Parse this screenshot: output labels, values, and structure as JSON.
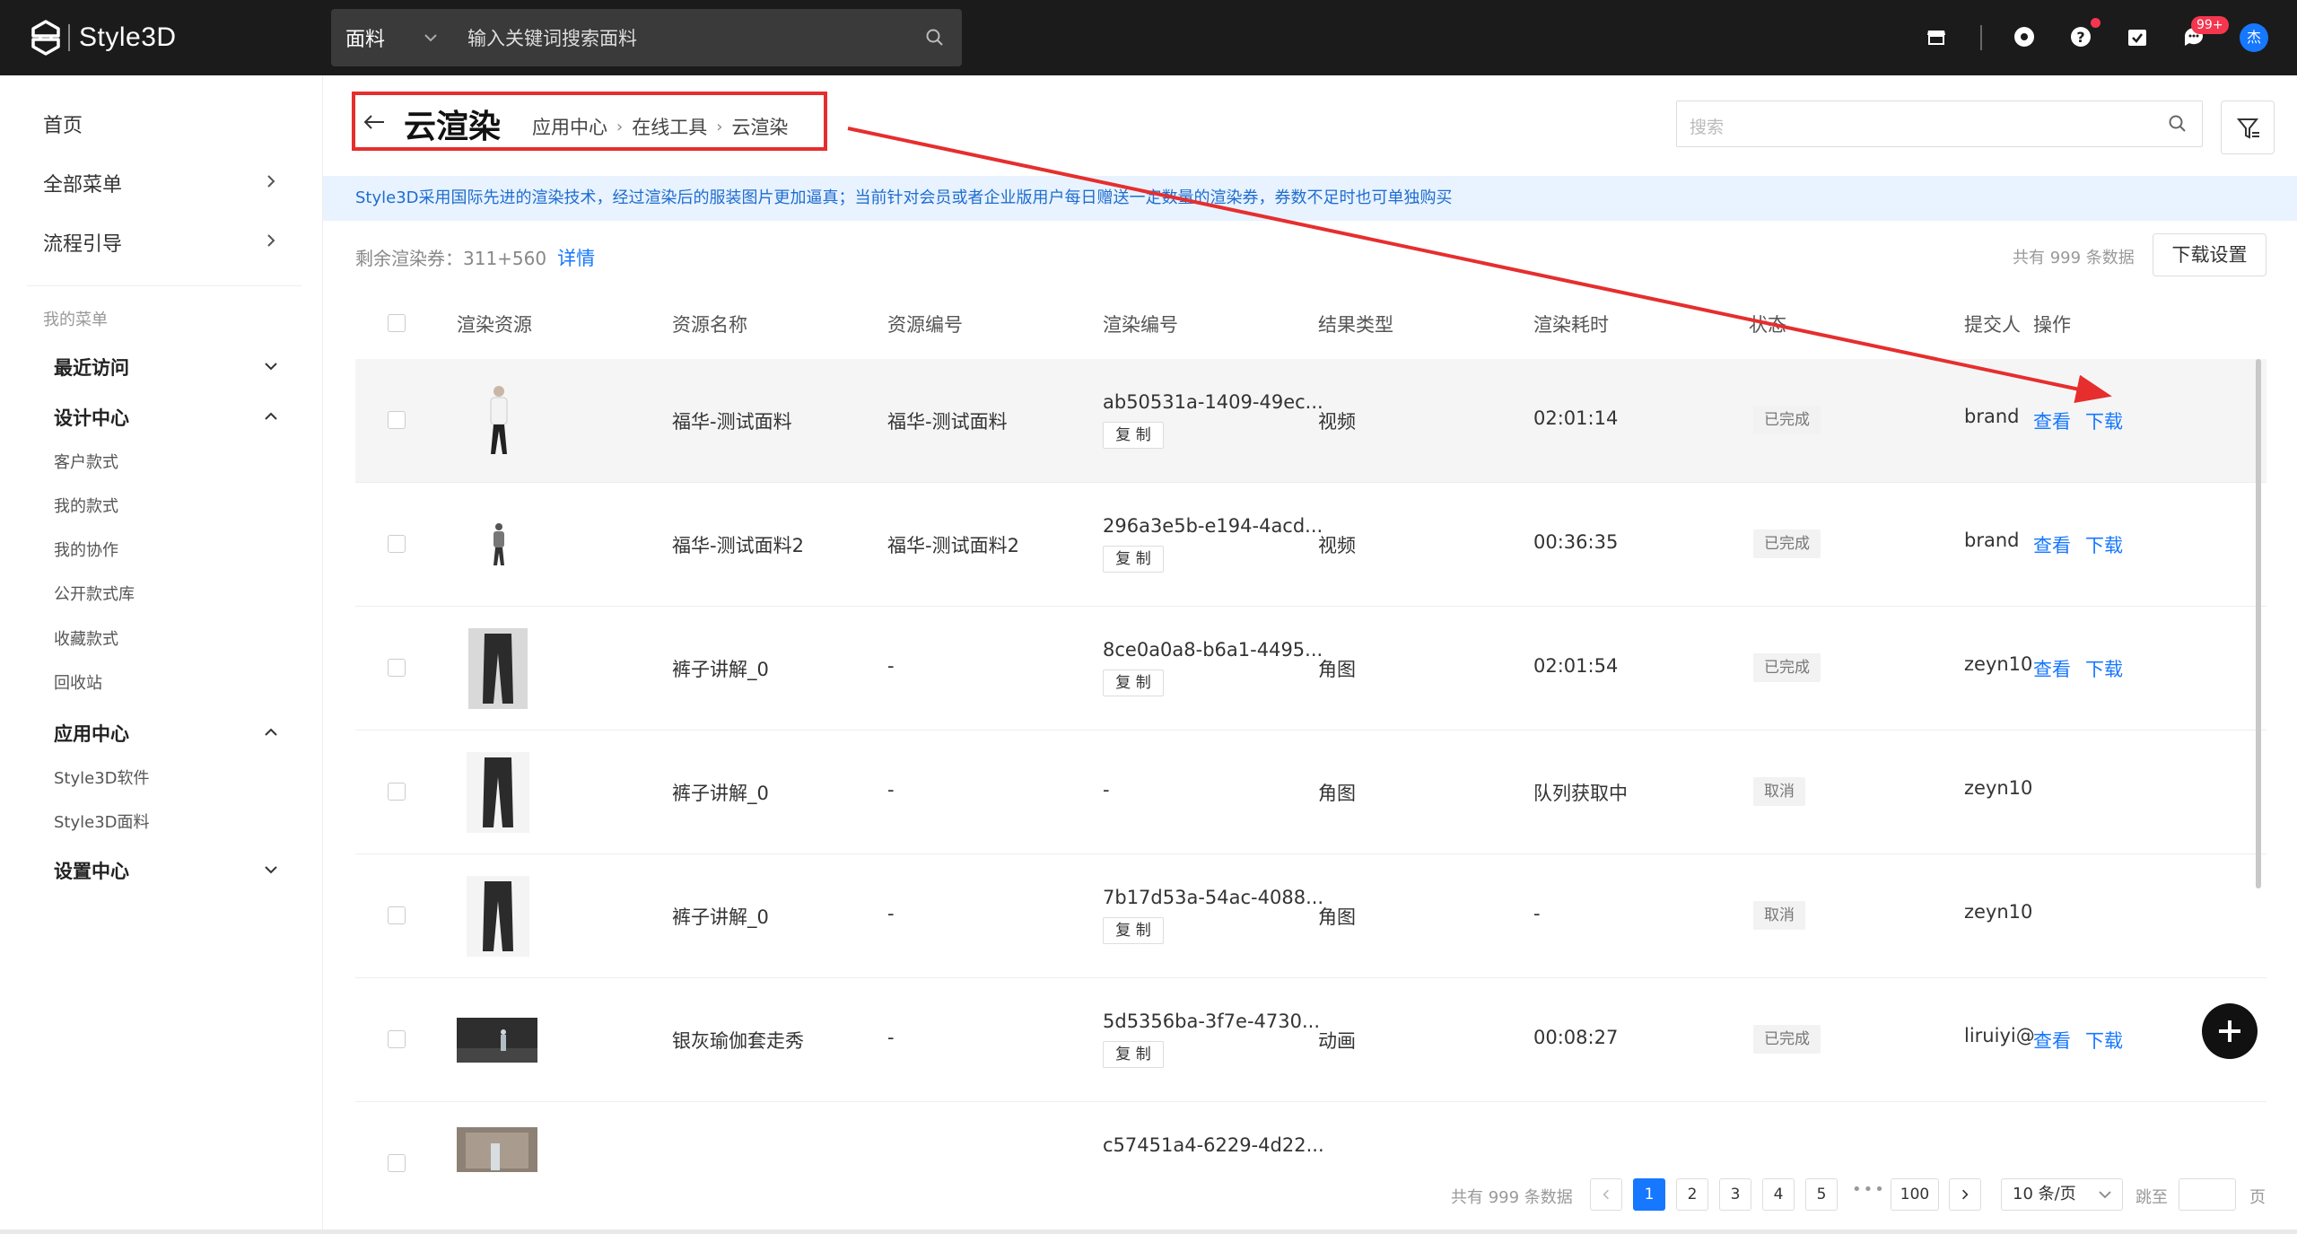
{
  "app": {
    "name": "Style3D"
  },
  "topbar": {
    "category": "面料",
    "search_placeholder": "输入关键词搜索面料",
    "badge_count": "99+",
    "avatar_text": "杰"
  },
  "sidebar": {
    "top_items": [
      {
        "label": "首页"
      },
      {
        "label": "全部菜单"
      },
      {
        "label": "流程引导"
      }
    ],
    "my_menu_label": "我的菜单",
    "groups": {
      "recent": "最近访问",
      "design": "设计中心",
      "apps": "应用中心",
      "settings": "设置中心"
    },
    "design_items": [
      "客户款式",
      "我的款式",
      "我的协作",
      "公开款式库",
      "收藏款式",
      "回收站"
    ],
    "app_items": [
      "Style3D软件",
      "Style3D面料"
    ]
  },
  "header": {
    "title": "云渲染",
    "breadcrumb": [
      "应用中心",
      "在线工具",
      "云渲染"
    ],
    "search_placeholder": "搜索"
  },
  "notice": "Style3D采用国际先进的渲染技术，经过渲染后的服装图片更加逼真；当前针对会员或者企业版用户每日赠送一定数量的渲染券，券数不足时也可单独购买",
  "stats": {
    "remain_label": "剩余渲染券：311+560",
    "detail_link": "详情",
    "total_text": "共有 999 条数据",
    "download_settings": "下载设置"
  },
  "table": {
    "columns": [
      "渲染资源",
      "资源名称",
      "资源编号",
      "渲染编号",
      "结果类型",
      "渲染耗时",
      "状态",
      "提交人",
      "操作"
    ],
    "copy_label": "复 制",
    "view_label": "查看",
    "download_label": "下载",
    "rows": [
      {
        "name": "福华-测试面料",
        "code": "福华-测试面料",
        "render_id": "ab50531a-1409-49ec...",
        "type": "视频",
        "duration": "02:01:14",
        "status": "已完成",
        "submitter": "brand"
      },
      {
        "name": "福华-测试面料2",
        "code": "福华-测试面料2",
        "render_id": "296a3e5b-e194-4acd...",
        "type": "视频",
        "duration": "00:36:35",
        "status": "已完成",
        "submitter": "brand"
      },
      {
        "name": "裤子讲解_0",
        "code": "-",
        "render_id": "8ce0a0a8-b6a1-4495...",
        "type": "角图",
        "duration": "02:01:54",
        "status": "已完成",
        "submitter": "zeyn10"
      },
      {
        "name": "裤子讲解_0",
        "code": "-",
        "render_id": "-",
        "type": "角图",
        "duration": "队列获取中",
        "status": "取消",
        "submitter": "zeyn10"
      },
      {
        "name": "裤子讲解_0",
        "code": "-",
        "render_id": "7b17d53a-54ac-4088...",
        "type": "角图",
        "duration": "-",
        "status": "取消",
        "submitter": "zeyn10"
      },
      {
        "name": "银灰瑜伽套走秀",
        "code": "-",
        "render_id": "5d5356ba-3f7e-4730...",
        "type": "动画",
        "duration": "00:08:27",
        "status": "已完成",
        "submitter": "liruiyi@"
      },
      {
        "render_id": "c57451a4-6229-4d22..."
      }
    ]
  },
  "pagination": {
    "total_text": "共有 999 条数据",
    "pages": [
      "1",
      "2",
      "3",
      "4",
      "5"
    ],
    "last_page": "100",
    "page_size": "10 条/页",
    "jump_label": "跳至",
    "page_suffix": "页"
  },
  "colors": {
    "accent": "#1677ff",
    "topbar_bg": "#1b1b1b",
    "annotation_red": "#e62e2e",
    "notice_bg": "#e8f3ff"
  }
}
